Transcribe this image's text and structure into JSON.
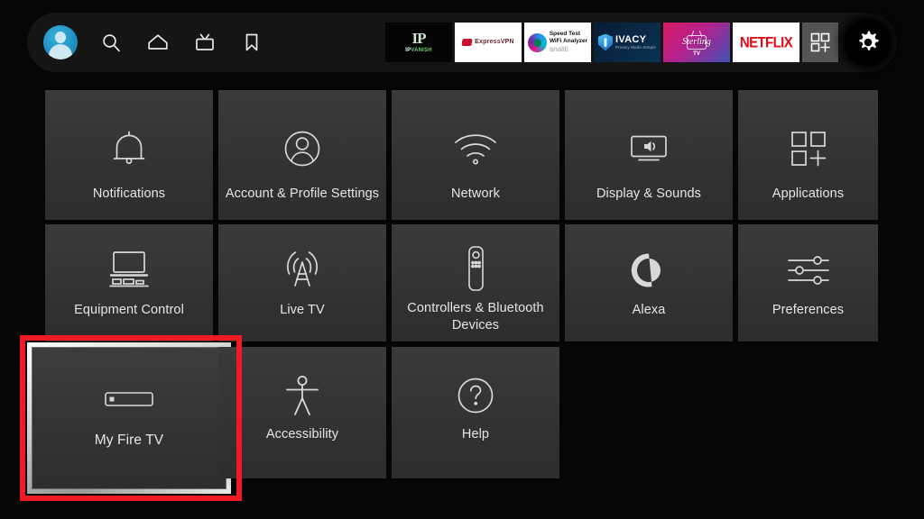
{
  "screen": {
    "name": "Fire TV Settings",
    "background_color": "#060606"
  },
  "top_bar": {
    "background_color": "#151515",
    "nav_items": [
      {
        "name": "profile-avatar",
        "label": "Profile",
        "icon": "user-avatar-icon",
        "color": "#1e8fc0"
      },
      {
        "name": "search",
        "label": "Search",
        "icon": "search-icon"
      },
      {
        "name": "home",
        "label": "Home",
        "icon": "home-icon"
      },
      {
        "name": "live-tv",
        "label": "Live TV",
        "icon": "tv-icon"
      },
      {
        "name": "watchlist",
        "label": "Watchlist",
        "icon": "bookmark-icon"
      }
    ],
    "apps": [
      {
        "name": "ipvanish",
        "label": "IP VANISH",
        "label_part1": "IP",
        "label_part2": "VANISH",
        "mark": "IP",
        "background": "#050505"
      },
      {
        "name": "expressvpn",
        "label": "ExpressVPN",
        "background": "#ffffff"
      },
      {
        "name": "analiti",
        "label": "Speed Test WiFi Analyzer",
        "line1": "Speed Test",
        "line2": "WiFi Analyzer",
        "line3": "analiti",
        "background": "#ffffff"
      },
      {
        "name": "ivacy",
        "label": "IVACY",
        "tagline": "Privacy Made Simple",
        "background": "#0b3254"
      },
      {
        "name": "sterling-tv",
        "label": "Sterling",
        "sub": "TV",
        "background": "#b5218e"
      },
      {
        "name": "netflix",
        "label": "NETFLIX",
        "background": "#ffffff",
        "brand_color": "#e50914"
      }
    ],
    "apps_button": {
      "name": "all-apps",
      "label": "Apps",
      "icon": "grid-plus-icon"
    },
    "settings_button": {
      "name": "settings",
      "label": "Settings",
      "icon": "gear-icon",
      "selected": true
    }
  },
  "grid": {
    "tiles": [
      {
        "id": "notifications",
        "label": "Notifications",
        "icon": "bell-icon",
        "selected": false
      },
      {
        "id": "account",
        "label": "Account & Profile Settings",
        "icon": "account-icon",
        "selected": false
      },
      {
        "id": "network",
        "label": "Network",
        "icon": "wifi-icon",
        "selected": false
      },
      {
        "id": "display",
        "label": "Display & Sounds",
        "icon": "display-sound-icon",
        "selected": false
      },
      {
        "id": "applications",
        "label": "Applications",
        "icon": "grid-plus-icon",
        "selected": false
      },
      {
        "id": "equipment",
        "label": "Equipment Control",
        "icon": "equipment-icon",
        "selected": false
      },
      {
        "id": "livetv",
        "label": "Live TV",
        "icon": "antenna-icon",
        "selected": false
      },
      {
        "id": "controllers",
        "label": "Controllers & Bluetooth Devices",
        "icon": "remote-icon",
        "selected": false
      },
      {
        "id": "alexa",
        "label": "Alexa",
        "icon": "alexa-icon",
        "selected": false
      },
      {
        "id": "preferences",
        "label": "Preferences",
        "icon": "sliders-icon",
        "selected": false
      },
      {
        "id": "myfiretv",
        "label": "My Fire TV",
        "icon": "firestick-icon",
        "selected": true
      },
      {
        "id": "accessibility",
        "label": "Accessibility",
        "icon": "accessibility-icon",
        "selected": false
      },
      {
        "id": "help",
        "label": "Help",
        "icon": "help-icon",
        "selected": false
      }
    ]
  },
  "annotation": {
    "name": "highlight-box",
    "color": "#ee1b24",
    "targets": "myfiretv"
  }
}
